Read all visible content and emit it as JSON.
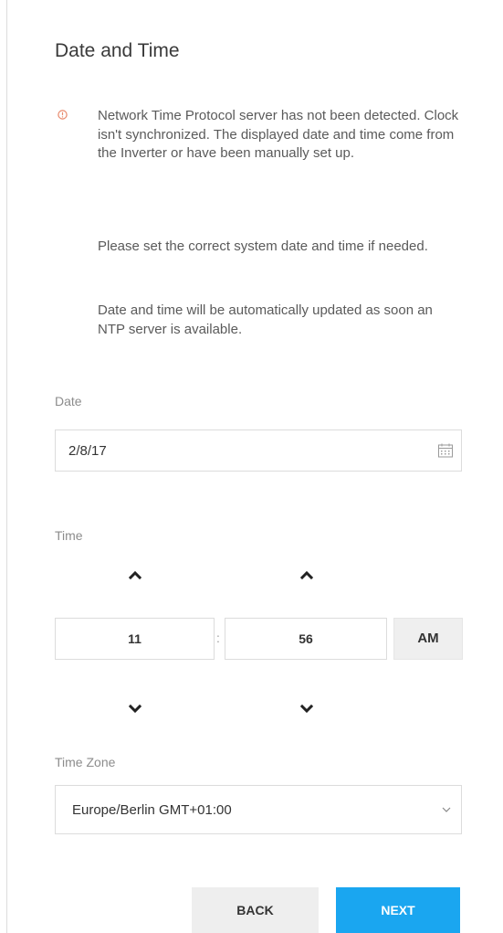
{
  "header": {
    "title": "Date and Time"
  },
  "notice": {
    "icon": "info-circle-icon",
    "icon_color": "#e8886a",
    "paragraphs": [
      "Network Time Protocol server has not been detected. Clock isn't synchronized. The displayed date and time come from the Inverter or have been manually set up.",
      "Please set the correct system date and time if needed.",
      "Date and time will be automatically updated as soon an NTP server is available."
    ]
  },
  "date": {
    "label": "Date",
    "value": "2/8/17",
    "icon": "calendar-icon"
  },
  "time": {
    "label": "Time",
    "hours": "11",
    "separator": ":",
    "minutes": "56",
    "period": "AM"
  },
  "timezone": {
    "label": "Time Zone",
    "value": "Europe/Berlin GMT+01:00",
    "icon": "chevron-down-icon"
  },
  "buttons": {
    "back": "BACK",
    "next": "NEXT"
  },
  "colors": {
    "accent": "#1aa6f0",
    "secondary_button": "#eeeeee",
    "border": "#dcdcdc"
  }
}
